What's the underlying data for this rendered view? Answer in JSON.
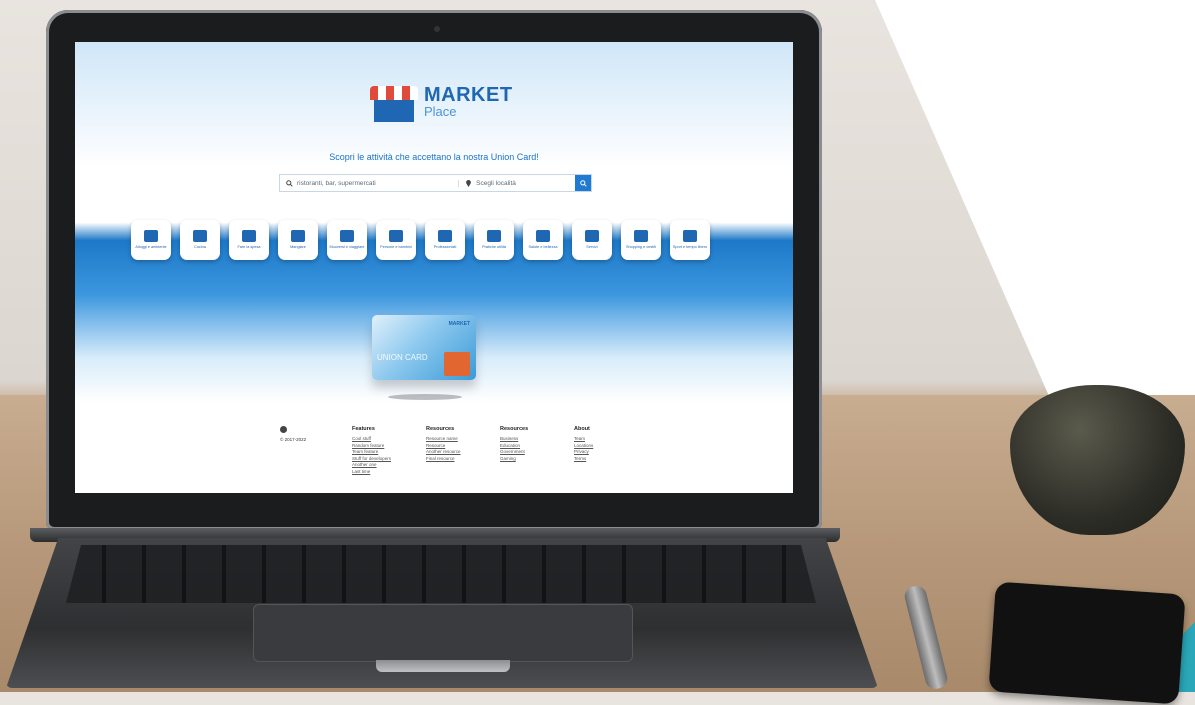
{
  "marketplace": {
    "logo_line1": "MARKET",
    "logo_line2": "Place",
    "tagline": "Scopri le attività che accettano la nostra Union Card!",
    "search": {
      "what_placeholder": "ristoranti, bar, supermercati",
      "where_placeholder": "Scegli località"
    },
    "categories": [
      {
        "label": "Alloggi e ambiente",
        "icon": "home-icon"
      },
      {
        "label": "Cucina",
        "icon": "kitchen-icon"
      },
      {
        "label": "Fare la spesa",
        "icon": "cart-icon"
      },
      {
        "label": "Mangiare",
        "icon": "utensils-icon"
      },
      {
        "label": "Muoversi e viaggiare",
        "icon": "building-icon"
      },
      {
        "label": "Persone e bambini",
        "icon": "family-icon"
      },
      {
        "label": "Professionisti",
        "icon": "person-icon"
      },
      {
        "label": "Pratiche utilità",
        "icon": "document-icon"
      },
      {
        "label": "Salute e bellezza",
        "icon": "health-icon"
      },
      {
        "label": "Servizi",
        "icon": "handshake-icon"
      },
      {
        "label": "Shopping e vestiti",
        "icon": "hanger-icon"
      },
      {
        "label": "Sport e tempo libero",
        "icon": "globe-icon"
      }
    ],
    "card": {
      "label": "UNION CARD",
      "logo": "MARKET"
    },
    "footer": {
      "copyright": "© 2017-2022",
      "columns": [
        {
          "title": "Features",
          "links": [
            "Cool stuff",
            "Random feature",
            "Team feature",
            "Stuff for developers",
            "Another one",
            "Last time"
          ]
        },
        {
          "title": "Resources",
          "links": [
            "Resource name",
            "Resource",
            "Another resource",
            "Final resource"
          ]
        },
        {
          "title": "Resources",
          "links": [
            "Business",
            "Education",
            "Government",
            "Gaming"
          ]
        },
        {
          "title": "About",
          "links": [
            "Team",
            "Locations",
            "Privacy",
            "Terms"
          ]
        }
      ]
    }
  }
}
